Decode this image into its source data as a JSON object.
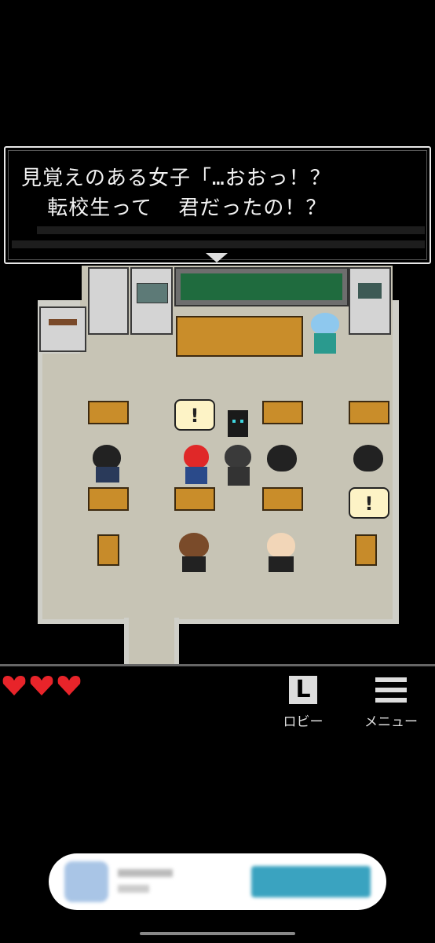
{
  "dialog": {
    "line1": "見覚えのある女子「…おおっ！？",
    "line2": "  転校生って  君だったの！？"
  },
  "scene": {
    "bubble_mark": "!"
  },
  "hud": {
    "hearts": 3,
    "lobby_icon_letter": "L",
    "lobby_label": "ロビー",
    "menu_label": "メニュー"
  },
  "colors": {
    "heart": "#e8242a",
    "chalkboard": "#1f6b3e",
    "floor": "#c7c4b5"
  },
  "icons": [
    "heart-icon",
    "lobby-icon",
    "menu-icon",
    "next-arrow-icon"
  ]
}
